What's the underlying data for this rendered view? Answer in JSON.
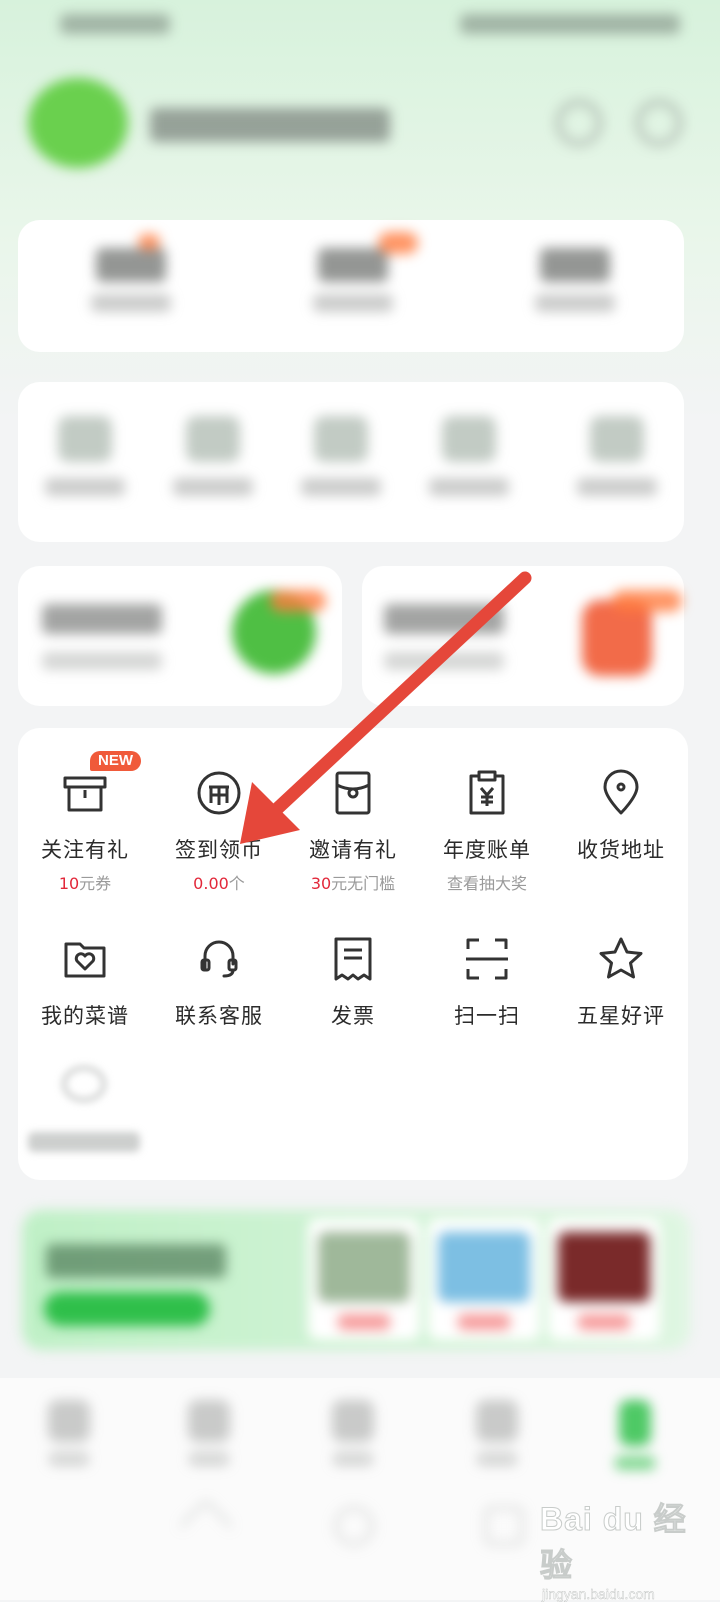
{
  "colors": {
    "accent_green": "#2fbf4a",
    "annotation_arrow": "#e5473a",
    "new_badge": "#f05a3a",
    "highlight_red": "#e2283a"
  },
  "services": {
    "row1": [
      {
        "label": "关注有礼",
        "sub_accent": "10",
        "sub_rest": "元券",
        "icon": "gift-box-icon",
        "badge": "NEW"
      },
      {
        "label": "签到领币",
        "sub_accent": "0.00",
        "sub_rest": "个",
        "icon": "coin-icon"
      },
      {
        "label": "邀请有礼",
        "sub_accent": "30",
        "sub_rest": "元无门槛",
        "icon": "red-envelope-icon"
      },
      {
        "label": "年度账单",
        "sub_accent": "",
        "sub_rest": "查看抽大奖",
        "icon": "bill-clipboard-icon"
      },
      {
        "label": "收货地址",
        "sub_accent": "",
        "sub_rest": "",
        "icon": "location-pin-icon"
      }
    ],
    "row2": [
      {
        "label": "我的菜谱",
        "icon": "recipe-heart-icon"
      },
      {
        "label": "联系客服",
        "icon": "headset-icon"
      },
      {
        "label": "发票",
        "icon": "invoice-icon"
      },
      {
        "label": "扫一扫",
        "icon": "scan-icon"
      },
      {
        "label": "五星好评",
        "icon": "star-icon"
      }
    ]
  },
  "watermark": {
    "logo_text": "Bai du 经验",
    "url": "jingyan.baidu.com"
  }
}
